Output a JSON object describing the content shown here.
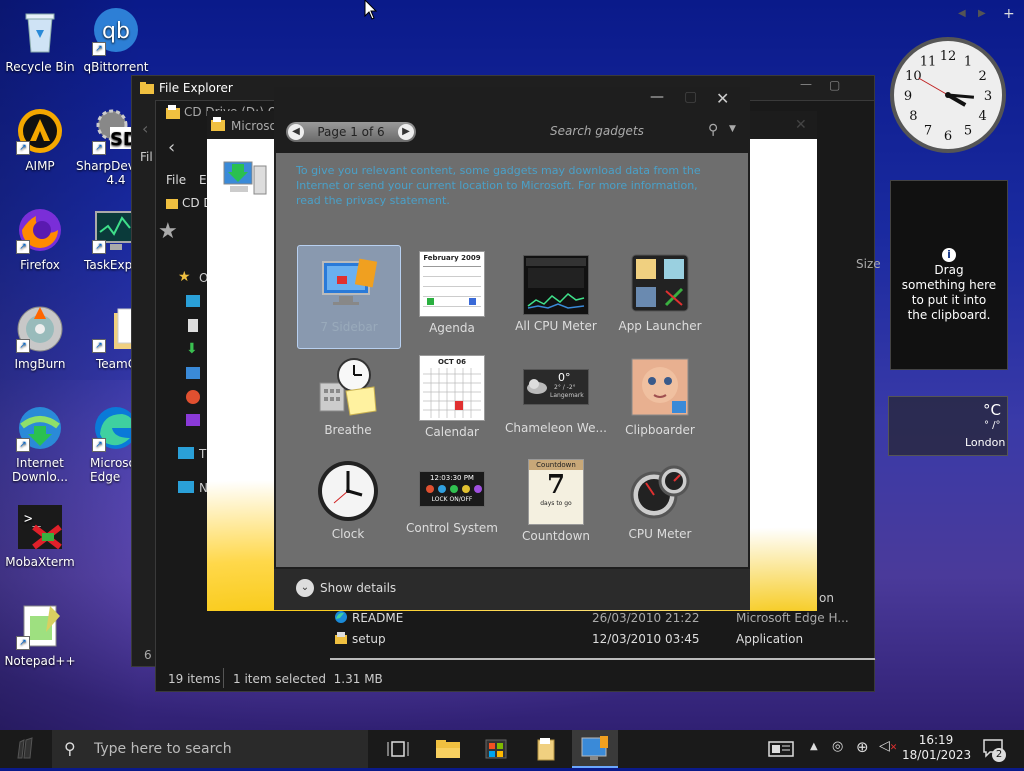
{
  "desktop": {
    "icons": [
      {
        "label": "Recycle Bin"
      },
      {
        "label": "qBittorrent"
      },
      {
        "label": "AIMP"
      },
      {
        "label": "SharpDevelop 4.4"
      },
      {
        "label": "Firefox"
      },
      {
        "label": "TaskExplo"
      },
      {
        "label": "ImgBurn"
      },
      {
        "label": "TeamC"
      },
      {
        "label": "Internet Downlo..."
      },
      {
        "label": "Microso Edge"
      },
      {
        "label": "MobaXterm"
      },
      {
        "label": "Notepad++"
      }
    ]
  },
  "file_explorer": {
    "title": "File Explorer",
    "back_window_path": "CD Drive (D:) OF",
    "front_window_path": "CD D",
    "front_window_title": "Microso",
    "menu": [
      "File",
      "Ed"
    ],
    "back_menu": "Fil",
    "column_size": "Size",
    "nav_partial": [
      "O",
      "T",
      "N"
    ],
    "rows": [
      {
        "name": "README",
        "date": "26/03/2010 21:22",
        "type": "Microsoft Edge H..."
      },
      {
        "name": "setup",
        "date": "12/03/2010 03:45",
        "type": "Application"
      }
    ],
    "partial_type_above": "on",
    "left_count_partial": "6",
    "status": {
      "items": "19 items",
      "selected": "1 item selected  1.31 MB"
    }
  },
  "gadget_gallery": {
    "page_label": "Page 1 of 6",
    "search_placeholder": "Search gadgets",
    "notice": "To give you relevant content, some gadgets may download data from the Internet or send your current location to Microsoft. For more information, read the privacy statement.",
    "gadgets": [
      {
        "name": "7 Sidebar",
        "selected": true
      },
      {
        "name": "Agenda"
      },
      {
        "name": "All CPU Meter"
      },
      {
        "name": "App Launcher"
      },
      {
        "name": "Breathe"
      },
      {
        "name": "Calendar"
      },
      {
        "name": "Chameleon We..."
      },
      {
        "name": "Clipboarder"
      },
      {
        "name": "Clock"
      },
      {
        "name": "Control System"
      },
      {
        "name": "Countdown"
      },
      {
        "name": "CPU Meter"
      }
    ],
    "agenda_month": "February 2009",
    "calendar_month": "OCT 06",
    "countdown_title": "Countdown",
    "countdown_days": "7",
    "countdown_sub": "days to go",
    "control_time": "12:03:30 PM",
    "control_lock": "LOCK ON/OFF",
    "chameleon_temp": "0°",
    "chameleon_range": "2° / -2°",
    "chameleon_place": "Langemark",
    "show_details": "Show details"
  },
  "sidebar": {
    "clock_numbers": [
      "12",
      "1",
      "2",
      "3",
      "4",
      "5",
      "6",
      "7",
      "8",
      "9",
      "10",
      "11"
    ],
    "clipboard_text": "Drag something here to put it into the clipboard.",
    "weather_unit": "°C",
    "weather_range": "° /°",
    "weather_city": "London"
  },
  "taskbar": {
    "search_placeholder": "Type here to search",
    "time": "16:19",
    "date": "18/01/2023",
    "notifications": "2"
  }
}
